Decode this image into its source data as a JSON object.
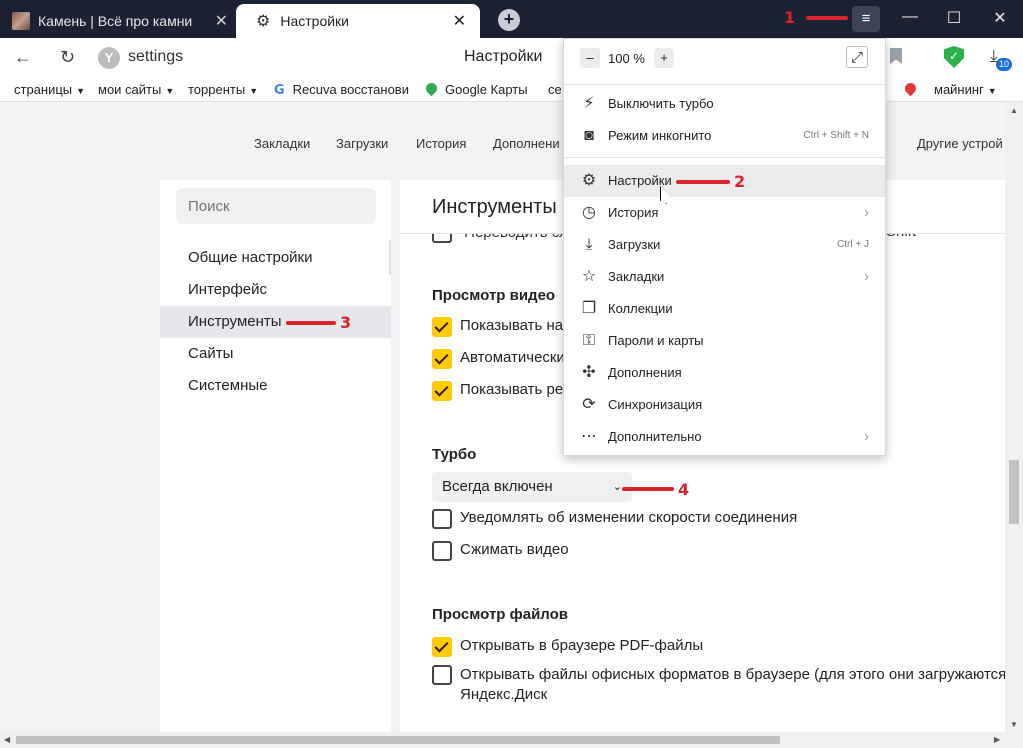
{
  "tabs": [
    {
      "title": "Камень | Всё про камни",
      "close": "✕"
    },
    {
      "title": "Настройки",
      "close": "✕"
    }
  ],
  "new_tab": "+",
  "window_controls": {
    "menu": "≡",
    "minimize": "—",
    "maximize": "☐",
    "close": "✕"
  },
  "address_bar": {
    "back": "←",
    "reload": "↻",
    "site_icon": "Y",
    "url": "settings",
    "page_title": "Настройки",
    "download_badge": "10"
  },
  "bookmarks": [
    {
      "label": "страницы",
      "caret": "▼"
    },
    {
      "label": "мои сайты",
      "caret": "▼"
    },
    {
      "label": "торренты",
      "caret": "▼"
    },
    {
      "label": "Recuva восстанови",
      "icon": "G"
    },
    {
      "label": "Google Карты"
    },
    {
      "label": "се"
    },
    {
      "label": "майнинг",
      "caret": "▼"
    }
  ],
  "settings_nav": [
    "Закладки",
    "Загрузки",
    "История",
    "Дополнени",
    "Другие устрой"
  ],
  "sidebar": {
    "search_placeholder": "Поиск",
    "items": [
      "Общие настройки",
      "Интерфейс",
      "Инструменты",
      "Сайты",
      "Системные"
    ]
  },
  "content": {
    "title": "Инструменты",
    "cut_row": "Переводить сл",
    "cut_row_tail": "Shift",
    "video_section": {
      "title": "Просмотр видео",
      "options": [
        {
          "label": "Показывать на",
          "checked": true
        },
        {
          "label": "Автоматически",
          "checked": true
        },
        {
          "label": "Показывать ре",
          "checked": true
        }
      ]
    },
    "turbo_section": {
      "title": "Турбо",
      "select_value": "Всегда включен",
      "select_chevron": "⌄",
      "options": [
        {
          "label": "Уведомлять об изменении скорости соединения",
          "checked": false
        },
        {
          "label": "Сжимать видео",
          "checked": false
        }
      ]
    },
    "files_section": {
      "title": "Просмотр файлов",
      "options": [
        {
          "label": "Открывать в браузере PDF-файлы",
          "checked": true
        },
        {
          "label": "Открывать файлы офисных форматов в браузере (для этого они загружаются н",
          "label2": "Яндекс.Диск",
          "checked": false
        }
      ]
    }
  },
  "menu": {
    "zoom_minus": "–",
    "zoom_value": "100 %",
    "zoom_plus": "+",
    "fullscreen": "⤢",
    "items": [
      {
        "label": "Выключить турбо",
        "icon": "turbo-off-icon",
        "glyph": "⚡",
        "shortcut": "",
        "submenu": false
      },
      {
        "label": "Режим инкогнито",
        "icon": "incognito-icon",
        "glyph": "◙",
        "shortcut": "Ctrl + Shift + N",
        "submenu": false
      },
      {
        "label": "Настройки",
        "icon": "gear-icon",
        "glyph": "⚙",
        "shortcut": "",
        "submenu": false
      },
      {
        "label": "История",
        "icon": "history-icon",
        "glyph": "◷",
        "shortcut": "",
        "submenu": true
      },
      {
        "label": "Загрузки",
        "icon": "download-icon",
        "glyph": "⤓",
        "shortcut": "Ctrl + J",
        "submenu": false
      },
      {
        "label": "Закладки",
        "icon": "star-icon",
        "glyph": "☆",
        "shortcut": "",
        "submenu": true
      },
      {
        "label": "Коллекции",
        "icon": "collections-icon",
        "glyph": "❐",
        "shortcut": "",
        "submenu": false
      },
      {
        "label": "Пароли и карты",
        "icon": "key-icon",
        "glyph": "⚿",
        "shortcut": "",
        "submenu": false
      },
      {
        "label": "Дополнения",
        "icon": "puzzle-icon",
        "glyph": "✣",
        "shortcut": "",
        "submenu": false
      },
      {
        "label": "Синхронизация",
        "icon": "sync-icon",
        "glyph": "⟳",
        "shortcut": "",
        "submenu": false
      },
      {
        "label": "Дополнительно",
        "icon": "more-icon",
        "glyph": "⋯",
        "shortcut": "",
        "submenu": true
      }
    ],
    "submenu_arrow": "›"
  },
  "annotations": [
    "1",
    "2",
    "3",
    "4"
  ],
  "colors": {
    "annotation": "#d8232a",
    "checkbox": "#ffcc00",
    "titlebar": "#1c2233",
    "shield": "#2bb24c"
  }
}
